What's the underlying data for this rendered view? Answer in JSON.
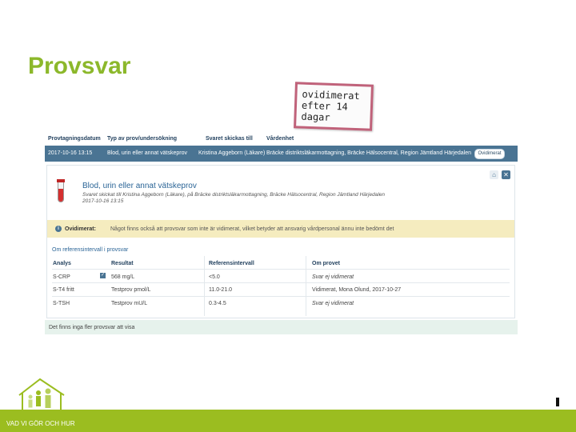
{
  "slide": {
    "title": "Provsvar",
    "note_lines": [
      "ovidimerat",
      "efter 14",
      "dagar"
    ],
    "footer_text": "VAD VI GÖR OCH HUR"
  },
  "results_panel": {
    "columns": [
      "Provtagningsdatum",
      "Typ av prov/undersökning",
      "Svaret skickas till",
      "Vårdenhet"
    ],
    "summary_row": {
      "date": "2017-10-16 13:15",
      "type": "Blod, urin eller annat vätskeprov",
      "sent_to": "Kristina Aggeborn (Läkare)",
      "unit": "Bräcke distriktsläkarmottagning, Bräcke Hälsocentral, Region Jämtland Härjedalen",
      "button": "Ovidimerat"
    },
    "detail": {
      "title": "Blod, urin eller annat vätskeprov",
      "sub_line": "Svaret skickat till Kristina Aggeborn (Läkare), på Bräcke distriktsläkarmottagning, Bräcke Hälsocentral, Region Jämtland Härjedalen",
      "date": "2017-10-16 13:15",
      "home_icon": "home-icon",
      "close_icon": "close-icon"
    },
    "warning": {
      "label": "Ovidimerat:",
      "text": "Något finns också att provsvar som inte är vidimerat, vilket betyder att ansvarig vårdpersonal ännu inte bedömt det"
    },
    "reference_link": "Om referensintervall i provsvar",
    "table": {
      "headers": [
        "Analys",
        "Resultat",
        "Referensintervall",
        "Om provet"
      ],
      "rows": [
        {
          "analys": "S-CRP",
          "resultat": "568 mg/L",
          "ref": "<5.0",
          "om": "Svar ej vidimerat"
        },
        {
          "analys": "S-T4 fritt",
          "resultat": "Testprov pmol/L",
          "ref": "11.0-21.0",
          "om": "Vidimerat, Mona Olund, 2017-10-27"
        },
        {
          "analys": "S-TSH",
          "resultat": "Testprov mU/L",
          "ref": "0.3-4.5",
          "om": "Svar ej vidimerat"
        }
      ]
    },
    "footer": "Det finns inga fler provsvar att visa"
  },
  "colors": {
    "accent_green": "#8cb82b",
    "header_blue": "#4a7493",
    "warning_bg": "#f5ecbf",
    "note_border": "#c0627a"
  }
}
